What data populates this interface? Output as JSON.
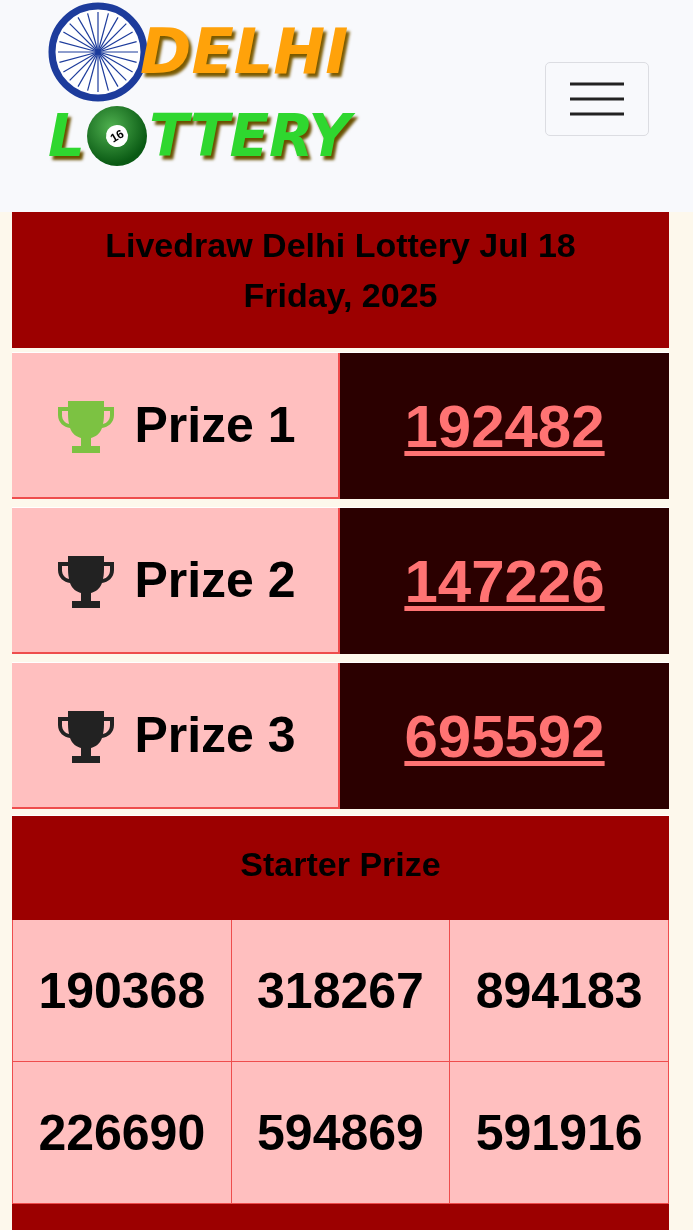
{
  "header": {
    "logo": {
      "line_1": "DELHI",
      "line_2_start": "L",
      "ball_number": "16",
      "line_2_end": "TTERY"
    },
    "menu_button": {
      "expanded": false
    }
  },
  "title": "Livedraw Delhi Lottery Jul 18 Friday, 2025",
  "prizes": [
    {
      "label": "Prize 1",
      "number": "192482",
      "color": "#7cc242"
    },
    {
      "label": "Prize 2",
      "number": "147226",
      "color": "#222222"
    },
    {
      "label": "Prize 3",
      "number": "695592",
      "color": "#222222"
    }
  ],
  "starter": {
    "heading": "Starter Prize",
    "numbers": [
      "190368",
      "318267",
      "894183",
      "226690",
      "594869",
      "591916"
    ]
  }
}
